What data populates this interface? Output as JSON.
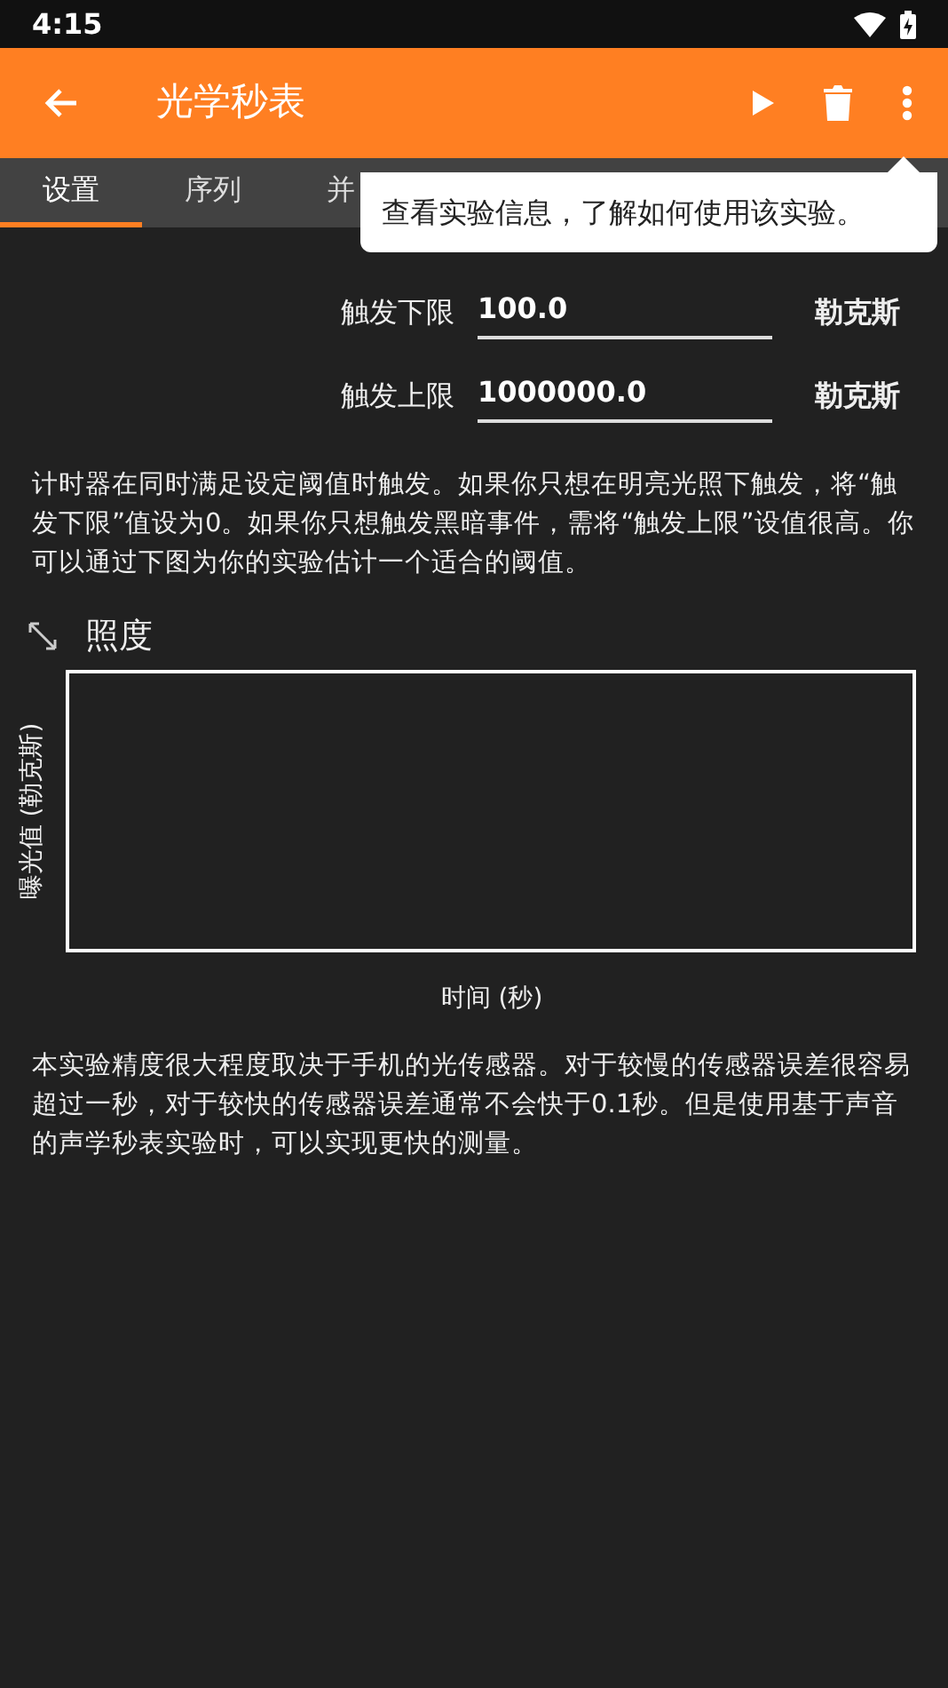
{
  "status_bar": {
    "time": "4:15"
  },
  "app_bar": {
    "title": "光学秒表"
  },
  "tabs": [
    {
      "label": "设置",
      "selected": true
    },
    {
      "label": "序列",
      "selected": false
    },
    {
      "label": "并",
      "selected": false
    }
  ],
  "tooltip": {
    "text": "查看实验信息，了解如何使用该实验。"
  },
  "fields": [
    {
      "label": "触发下限",
      "value": "100.0",
      "unit": "勒克斯"
    },
    {
      "label": "触发上限",
      "value": "1000000.0",
      "unit": "勒克斯"
    }
  ],
  "description": "计时器在同时满足设定阈值时触发。如果你只想在明亮光照下触发，将“触发下限”值设为0。如果你只想触发黑暗事件，需将“触发上限”设值很高。你可以通过下图为你的实验估计一个适合的阈值。",
  "graph": {
    "title": "照度",
    "ylabel": "曝光值 (勒克斯)",
    "xlabel": "时间 (秒)"
  },
  "note": "本实验精度很大程度取决于手机的光传感器。对于较慢的传感器误差很容易超过一秒，对于较快的传感器误差通常不会快于0.1秒。但是使用基于声音的声学秒表实验时，可以实现更快的测量。"
}
